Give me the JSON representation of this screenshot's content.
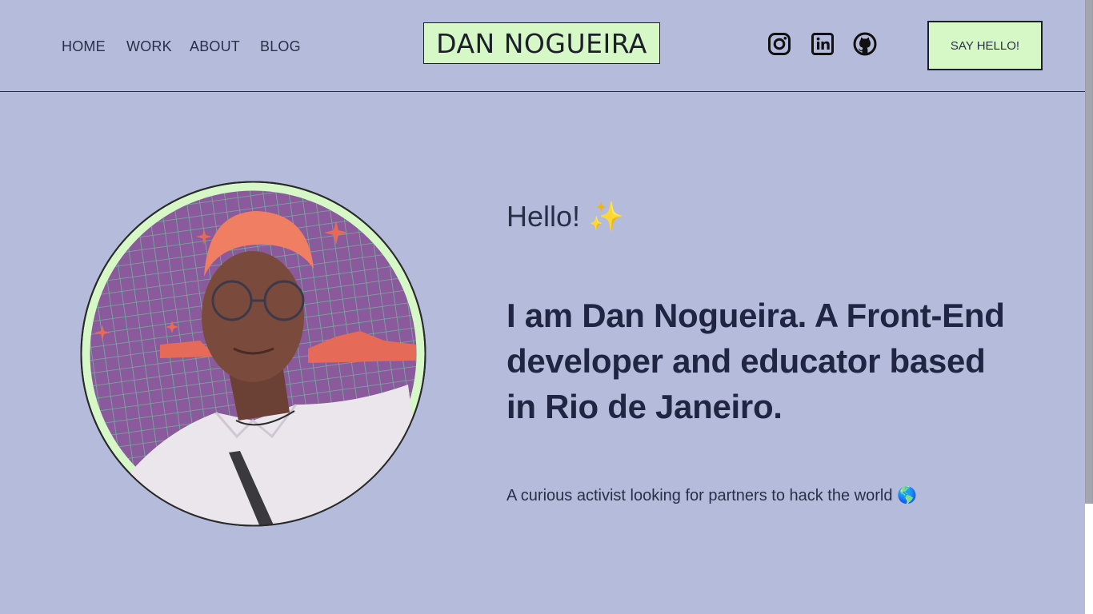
{
  "nav": {
    "items": [
      {
        "label": "HOME"
      },
      {
        "label": "WORK"
      },
      {
        "label": "ABOUT"
      },
      {
        "label": "BLOG"
      }
    ]
  },
  "brand": {
    "logo_text": "DAN NOGUEIRA"
  },
  "social": {
    "icons": [
      "instagram-icon",
      "linkedin-icon",
      "github-icon"
    ]
  },
  "cta": {
    "say_hello_label": "SAY HELLO!"
  },
  "hero": {
    "greeting": "Hello! ✨",
    "headline": "I am Dan Nogueira. A Front-End developer and educator based in Rio de Janeiro.",
    "tagline": "A curious activist looking for partners to hack the world 🌎"
  },
  "colors": {
    "background": "#b5bcdb",
    "accent": "#d6f7c6",
    "text": "#2a2f48",
    "headline": "#1f2542"
  }
}
